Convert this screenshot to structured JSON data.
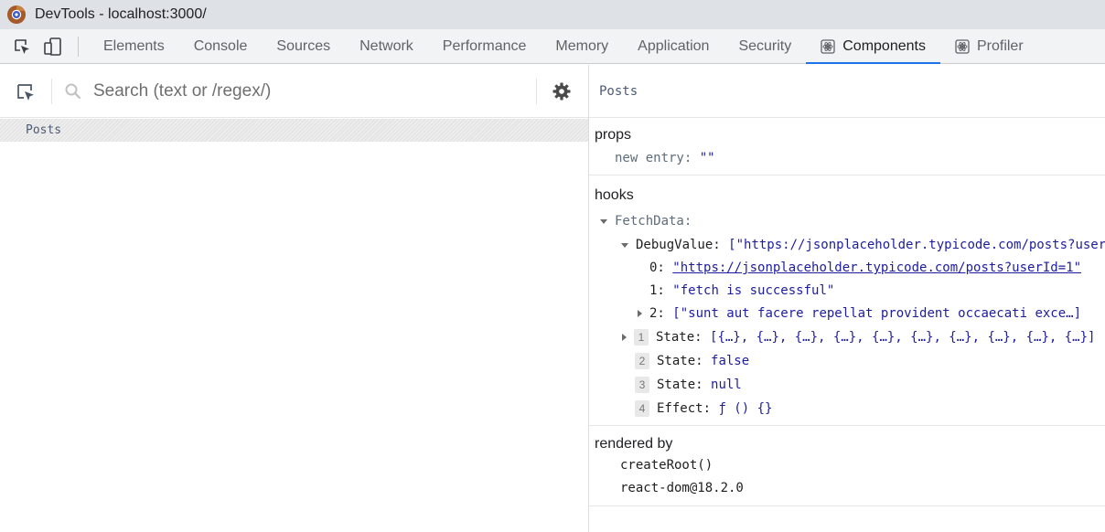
{
  "window": {
    "title": "DevTools - localhost:3000/",
    "logo_icon": "chrome-devtools-logo"
  },
  "toolbar": {
    "inspect_icon": "inspect-element-icon",
    "device_icon": "device-toolbar-icon",
    "tabs": [
      {
        "label": "Elements"
      },
      {
        "label": "Console"
      },
      {
        "label": "Sources"
      },
      {
        "label": "Network"
      },
      {
        "label": "Performance"
      },
      {
        "label": "Memory"
      },
      {
        "label": "Application"
      },
      {
        "label": "Security"
      },
      {
        "label": "Components",
        "icon": "react-icon",
        "active": true
      },
      {
        "label": "Profiler",
        "icon": "react-icon"
      }
    ]
  },
  "left_panel": {
    "search": {
      "placeholder": "Search (text or /regex/)",
      "value": ""
    },
    "tree": [
      {
        "label": "Posts",
        "selected": true
      }
    ]
  },
  "right_panel": {
    "component_name": "Posts",
    "props": {
      "title": "props",
      "entries": [
        {
          "key": "new entry",
          "value": "\"\""
        }
      ]
    },
    "hooks": {
      "title": "hooks",
      "custom_hook": "FetchData:",
      "debug_value_key": "DebugValue:",
      "debug_value_summary": "[\"https://jsonplaceholder.typicode.com/posts?user",
      "debug_items": [
        {
          "index": "0:",
          "value": "\"https://jsonplaceholder.typicode.com/posts?userId=1\""
        },
        {
          "index": "1:",
          "value": "\"fetch is successful\""
        },
        {
          "index": "2:",
          "value": "[\"sunt aut facere repellat provident occaecati exce…]"
        }
      ],
      "items": [
        {
          "badge": "1",
          "key": "State:",
          "value": "[{…}, {…}, {…}, {…}, {…}, {…}, {…}, {…}, {…}, {…}]"
        },
        {
          "badge": "2",
          "key": "State:",
          "value": "false"
        },
        {
          "badge": "3",
          "key": "State:",
          "value": "null"
        },
        {
          "badge": "4",
          "key": "Effect:",
          "value": "ƒ () {}"
        }
      ]
    },
    "rendered_by": {
      "title": "rendered by",
      "items": [
        "createRoot()",
        "react-dom@18.2.0"
      ]
    }
  },
  "colors": {
    "accent": "#1a73e8",
    "value_blue": "#1d1da0",
    "title_bar_bg": "#dee1e6"
  }
}
